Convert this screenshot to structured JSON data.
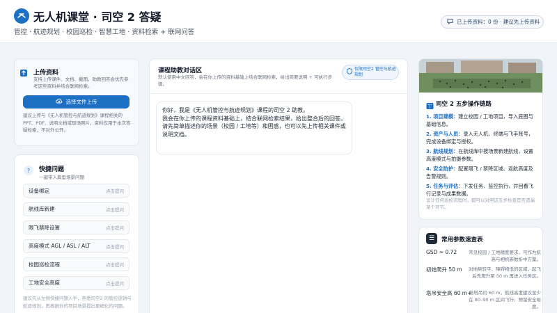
{
  "header": {
    "title": "无人机课堂 · 司空 2 答疑",
    "subtitle": "管控 · 航迹规划 · 校园巡检 · 智慧工地 · 资料检索 + 联网问答",
    "status": "已上传资料：0 份 · 建议先上传资料"
  },
  "upload": {
    "title": "上传资料",
    "desc": "支持上传课件、文档、截图，助教回答会优先参考这些资料并结合联网检索。",
    "button": "选择文件上传",
    "note": "建议上传与《无人机管控与航迹规划》课程相关的 PPT、PDF、说明文档或现场照片，资料仅用于本次答疑检索，不对外公开。"
  },
  "quick": {
    "title": "快捷问题",
    "subtitle": "一键带入典型场景问题",
    "items": [
      {
        "label": "设备绑定",
        "hint": "点击提问"
      },
      {
        "label": "航线库新建",
        "hint": "点击提问"
      },
      {
        "label": "限飞禁降设置",
        "hint": "点击提问"
      },
      {
        "label": "高度模式 AGL / ASL / ALT",
        "hint": "点击提问"
      },
      {
        "label": "校园巡检流程",
        "hint": "点击提问"
      },
      {
        "label": "工地安全高度",
        "hint": "点击提问"
      }
    ],
    "footer": "建议先从左侧快捷问题入手，熟悉司空2 的管控逻辑与航迹规划，再根据你的项目场景提出更细化的问题。"
  },
  "chat": {
    "title": "课程助教对话区",
    "desc": "默认使用中文回答，会在你上传的资料基础上结合联网检索，给出简要说明 + 可执行步骤。",
    "tag": "仅限司空2 管控与航迹规划",
    "message": [
      "你好，我是《无人机管控与航迹规划》课程的司空 2 助教。",
      "我会在你上传的课程资料基础上，结合联网检索结果，给出整合后的回答。",
      "请先简单描述你的场景（校园 / 工地等）和困惑，也可以先上传相关课件或说明文档。"
    ]
  },
  "steps": {
    "title": "司空 2 五步操作链路",
    "items": [
      {
        "key": "1. 项目建模",
        "text": "：建立校园 / 工地项目，导入底图与基础信息。"
      },
      {
        "key": "2. 资产与人员",
        "text": "：录入无人机、终端与飞手账号，完成设备绑定与授权。"
      },
      {
        "key": "3. 航线规划",
        "text": "：在航线库中按场景新建航线，设置高度模式与拍摄参数。"
      },
      {
        "key": "4. 安全防护",
        "text": "：配置限飞 / 禁降区域、返航高度及告警规则。"
      },
      {
        "key": "5. 任务与评估",
        "text": "：下发任务、监控执行，并回看飞行记录与成果数据。"
      }
    ],
    "footer": "设计任何巡检流程时，都可以对照这五步检查是否遗漏某个环节。"
  },
  "params": {
    "title": "常用参数速查表",
    "rows": [
      {
        "key": "GSD ≈ 0.72",
        "val": "常见校园 / 工地精度要求，可作为航高与相机参数折中方案。"
      },
      {
        "key": "初始爬升 50 m",
        "val": "对地势较平、障碍物低的区域，起飞后先爬升至 50 m 再进入任务区。"
      },
      {
        "key": "塔吊安全高 60 m+",
        "val": "若塔吊约 60 m，航线高度建议至少在 80–90 m 区间飞行，预留安全裕度。"
      }
    ]
  },
  "colors": {
    "brand": "#1d6fc4",
    "background": "#f1f4f8",
    "muted": "#6b7280"
  },
  "icons": {
    "logo": "drone-logo-icon",
    "status": "chat-bubble-icon",
    "upload": "upload-icon",
    "cloud": "cloud-upload-icon",
    "quick": "question-icon",
    "tag": "shield-icon",
    "steps": "book-icon",
    "params": "sliders-icon"
  }
}
